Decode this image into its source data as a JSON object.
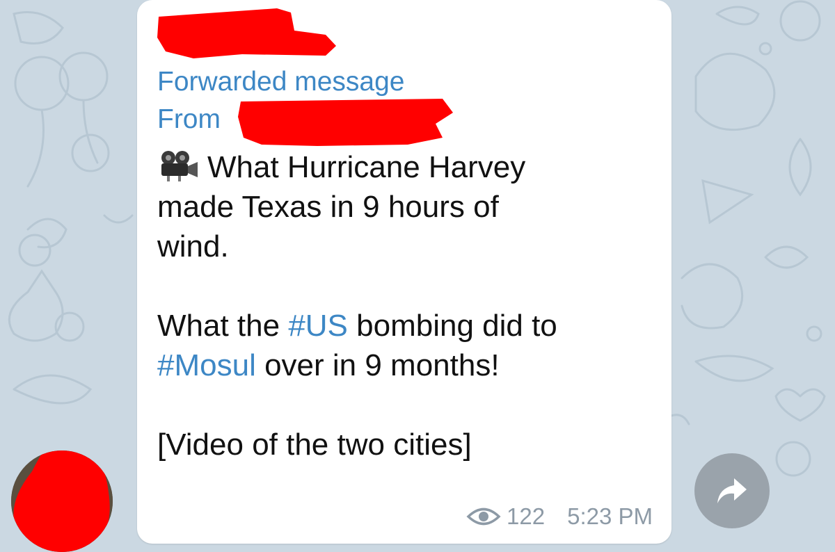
{
  "message": {
    "forward_label": "Forwarded message",
    "from_prefix": "From ",
    "line1": "What Hurricane Harvey",
    "line2": "made Texas in 9 hours of",
    "line3": "wind.",
    "line4_pre": "What the ",
    "hashtag1": "#US",
    "line4_post": " bombing did to",
    "hashtag2": "#Mosul",
    "line5_post": " over in 9 months!",
    "line6": "[Video of the two cities]",
    "views": "122",
    "time": "5:23 PM"
  },
  "icons": {
    "camera": "video-camera-icon",
    "eye": "eye-icon",
    "share": "share-arrow-icon"
  },
  "colors": {
    "link": "#3d87c5",
    "text": "#111111",
    "meta": "#8d9aa6",
    "background": "#cbd8e2",
    "bubble": "#ffffff",
    "redaction": "#ff0000",
    "share_button": "#9aa3ab"
  }
}
